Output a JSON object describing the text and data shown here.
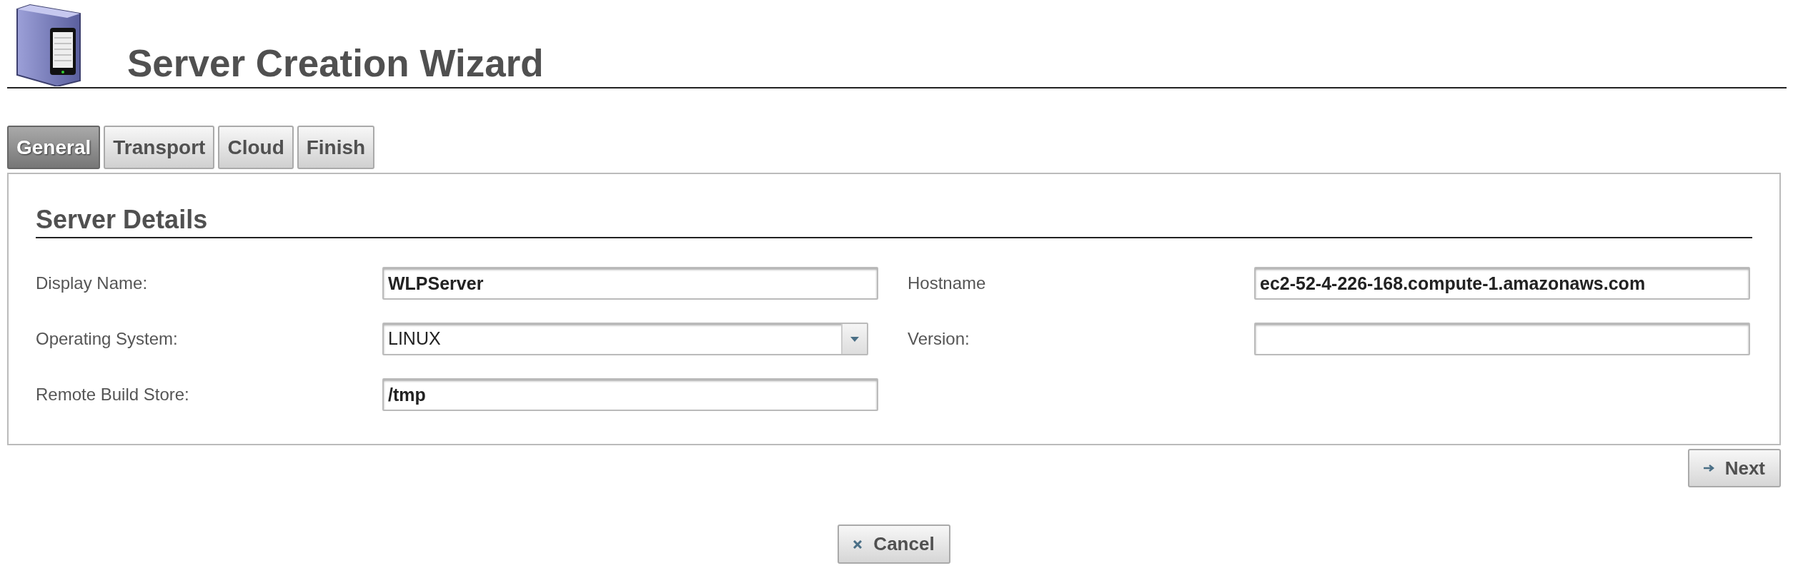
{
  "window": {
    "title": "Server Creation Wizard"
  },
  "tabs": [
    {
      "label": "General",
      "selected": true
    },
    {
      "label": "Transport",
      "selected": false
    },
    {
      "label": "Cloud",
      "selected": false
    },
    {
      "label": "Finish",
      "selected": false
    }
  ],
  "section": {
    "title": "Server Details"
  },
  "fields": [
    {
      "kind": "text",
      "label": "Display Name:",
      "value": "WLPServer"
    },
    {
      "kind": "text",
      "label": "Hostname",
      "value": "ec2-52-4-226-168.compute-1.amazonaws.com"
    },
    {
      "kind": "select",
      "label": "Operating System:",
      "value": "LINUX"
    },
    {
      "kind": "text",
      "label": "Version:"
    },
    {
      "kind": "text",
      "label": "Remote Build Store:",
      "value": "/tmp"
    }
  ],
  "buttons": {
    "next": "Next",
    "cancel": "Cancel"
  }
}
